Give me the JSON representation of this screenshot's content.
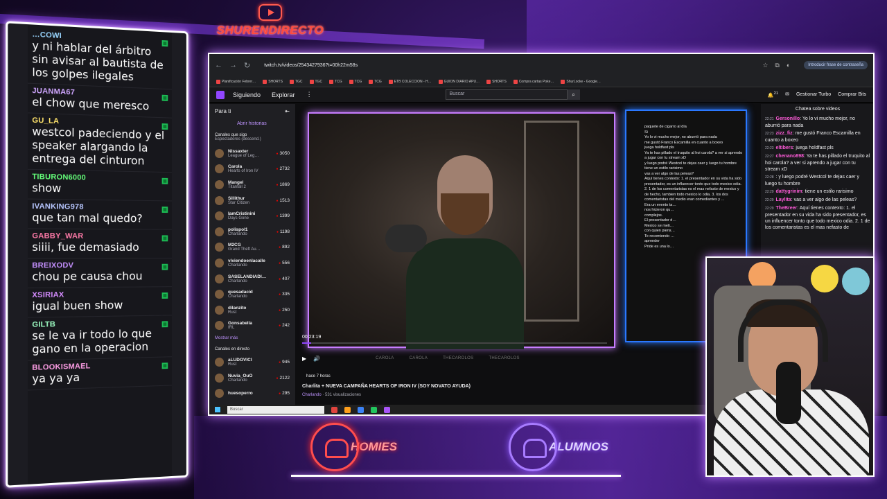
{
  "brand": {
    "title": "SHURENDIRECTO",
    "icon": "youtube-icon"
  },
  "chat": [
    {
      "user": "…COWI",
      "text": "y ni hablar del árbitro sin avisar al bautista de los golpes ilegales",
      "color": "#9ad6ff"
    },
    {
      "user": "JUANMA67",
      "text": "el chow que meresco",
      "color": "#cfa6ff"
    },
    {
      "user": "GU_LA",
      "text": "westcol padeciendo y el speaker alargando la entrega del cinturon",
      "color": "#ffe36b"
    },
    {
      "user": "TIBURON6000",
      "text": "show",
      "color": "#64ff7a"
    },
    {
      "user": "IVANKING978",
      "text": "que tan mal quedo?",
      "color": "#b8c7ff"
    },
    {
      "user": "GABBY_WAR",
      "text": "siiii, fue demasiado",
      "color": "#ff7aa8"
    },
    {
      "user": "BREIXODV",
      "text": "chou pe causa chou",
      "color": "#c590ff"
    },
    {
      "user": "XSIRIAX",
      "text": "igual buen show",
      "color": "#d58cff"
    },
    {
      "user": "GILTB",
      "text": "se le va ir todo lo que gano en la operacion",
      "color": "#9effc4"
    },
    {
      "user": "BLOOKISMAEL",
      "text": "ya ya ya",
      "color": "#ff9ee6"
    }
  ],
  "browser": {
    "url": "twitch.tv/videos/2543427936?t=00h22m58s",
    "password_button": "Introducir frase de contraseña",
    "bookmarks": [
      "Planificación Febrer…",
      "SHORTS",
      "TGC",
      "TGC",
      "TCG",
      "TCG",
      "TCG",
      "ETB COLECCION - H…",
      "GUION DIARIO APU…",
      "SHORTS",
      "Compra cartas Poke…",
      "ShurLocke - Google…"
    ]
  },
  "twitch": {
    "nav": {
      "following": "Siguiendo",
      "browse": "Explorar",
      "search_placeholder": "Buscar"
    },
    "notifications_count": "21",
    "manage_turbo": "Gestionar Turbo",
    "buy_bits": "Comprar Bits",
    "sidebar": {
      "title": "Para ti",
      "history": "Abrir historias",
      "followed_head": "Canales que sigo",
      "followed_sub": "Espectadores (descend.)",
      "channels": [
        {
          "name": "Nissaxter",
          "game": "League of Leg…",
          "viewers": "3050"
        },
        {
          "name": "Carola",
          "game": "Hearts of Iron IV",
          "viewers": "2732"
        },
        {
          "name": "Mangel",
          "game": "Titanfall 2",
          "viewers": "1869"
        },
        {
          "name": "Sillithur",
          "game": "Star Citizen",
          "viewers": "1513"
        },
        {
          "name": "IamCristinini",
          "game": "Days Gone",
          "viewers": "1399"
        },
        {
          "name": "polispol1",
          "game": "Charlando",
          "viewers": "1198"
        },
        {
          "name": "M2CG",
          "game": "Grand Theft Au…",
          "viewers": "892"
        },
        {
          "name": "viviendoenlacalle",
          "game": "Charlando",
          "viewers": "556"
        },
        {
          "name": "SASELANDIADI…",
          "game": "Charlando",
          "viewers": "407"
        },
        {
          "name": "quesadacid",
          "game": "Charlando",
          "viewers": "335"
        },
        {
          "name": "dilanzito",
          "game": "Rust",
          "viewers": "250"
        },
        {
          "name": "Gonsabella",
          "game": "IRL",
          "viewers": "242"
        }
      ],
      "show_more": "Mostrar más",
      "live_head": "Canales en directo",
      "live_channels": [
        {
          "name": "aLUDOVICI",
          "game": "Rust",
          "viewers": "945"
        },
        {
          "name": "Nuvia_OuO",
          "game": "Charlando",
          "viewers": "2122"
        },
        {
          "name": "huesoperro",
          "game": "",
          "viewers": "295"
        }
      ]
    },
    "player": {
      "time": "00:23:19",
      "progress": 0.03,
      "socials": [
        "CAROLA",
        "CAROLA",
        "THECAROLOS",
        "THECAROLOS"
      ]
    },
    "vod": {
      "ago": "hace 7 horas",
      "title": "Charlita + NUEVA CAMPAÑA HEARTS OF IRON IV (SOY NOVATO AYUDA)",
      "category": "Charlando",
      "views": " · 531 visualizaciones"
    },
    "inner_chat": [
      "paquete de cigarro al día",
      "Si",
      "Yo lo vi mucho mejor, no aburrió para nada",
      "me gustó Franco Escamilla en cuanto a boxeo",
      "juega holdfast pls",
      "Ya te has pillado el truquito al hoi carola? a ver si aprendo a jugar con tu stream xD",
      "y luego podré Westcol te dejas caer y luego tu hombre",
      "tiene un estilo rarisimo",
      "vas a ver algo de las peleas?",
      "Aquí tienes contexto: 1. el presentador en su vida ha sido presentador, es un influencer tonto que todo mexico odia. 2. 1 de los comentaristas es el mas nefasto de mexico y de hecho, tambien todo mexico lo odia. 3. los dos comentaristas del medio eran comediantes y ...",
      "Era un evento ta…",
      "nos hicieron qu…",
      "complejos.",
      "El presentador d…",
      "Mexico se meti…",
      "con quien piens…",
      "Te recomiendo …",
      "aprender",
      "Pride es una lo…"
    ],
    "side_chat": {
      "title": "Chatea sobre videos",
      "lines": [
        {
          "time": "22:21",
          "user": "Gersonillo",
          "text": "Yo lo vi mucho mejor, no aburrió para nada"
        },
        {
          "time": "22:23",
          "user": "zizz_fiz",
          "text": "me gustó Franco Escamilla en cuanto a boxeo"
        },
        {
          "time": "22:23",
          "user": "eltibers",
          "text": "juega holdfast pls"
        },
        {
          "time": "22:27",
          "user": "chenano898",
          "text": "Ya te has pillado el truquito al hoi carola? a ver si aprendo a jugar con tu stream xD"
        },
        {
          "time": "22:28",
          "user": "",
          "text": "y luego podré Westcol te dejas caer y luego tu hombre"
        },
        {
          "time": "22:29",
          "user": "dattygrinim",
          "text": "tiene un estilo rarisimo"
        },
        {
          "time": "22:29",
          "user": "Laylita",
          "text": "vas a ver algo de las peleas?"
        },
        {
          "time": "22:29",
          "user": "TheBreer",
          "text": "Aquí tienes contexto: 1. el presentador en su vida ha sido presentador, es un influencer tonto que todo mexico odia. 2. 1 de los comentaristas es el mas nefasto de"
        }
      ]
    },
    "taskbar_search": "Buscar"
  },
  "bottom": {
    "left": "HOMIES",
    "right": "ALUMNOS"
  }
}
